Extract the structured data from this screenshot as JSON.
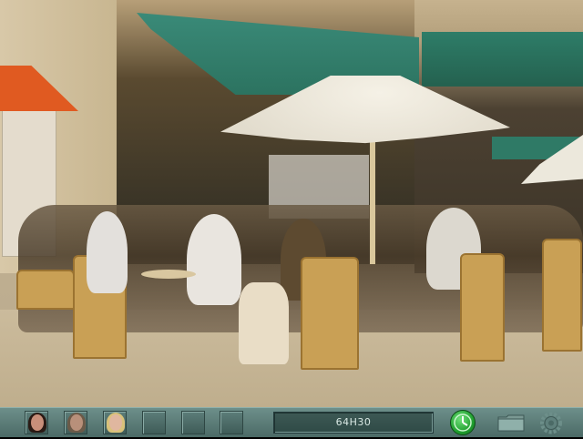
{
  "scene": {
    "description_icon": "cafe-terrace-scene"
  },
  "toolbar": {
    "portraits": [
      {
        "icon": "woman-dark-hair-portrait-icon"
      },
      {
        "icon": "man-portrait-icon"
      },
      {
        "icon": "blonde-woman-portrait-icon"
      }
    ],
    "empty_slots": 3,
    "time_display": "64H30",
    "clock_icon": "green-clock-icon",
    "folder_icon": "folder-icon",
    "settings_icon": "gear-icon"
  },
  "colors": {
    "toolbar": "#5b7c78",
    "clock_green": "#21a030",
    "awning_green": "#2c7360",
    "awning_orange": "#e05a21"
  }
}
